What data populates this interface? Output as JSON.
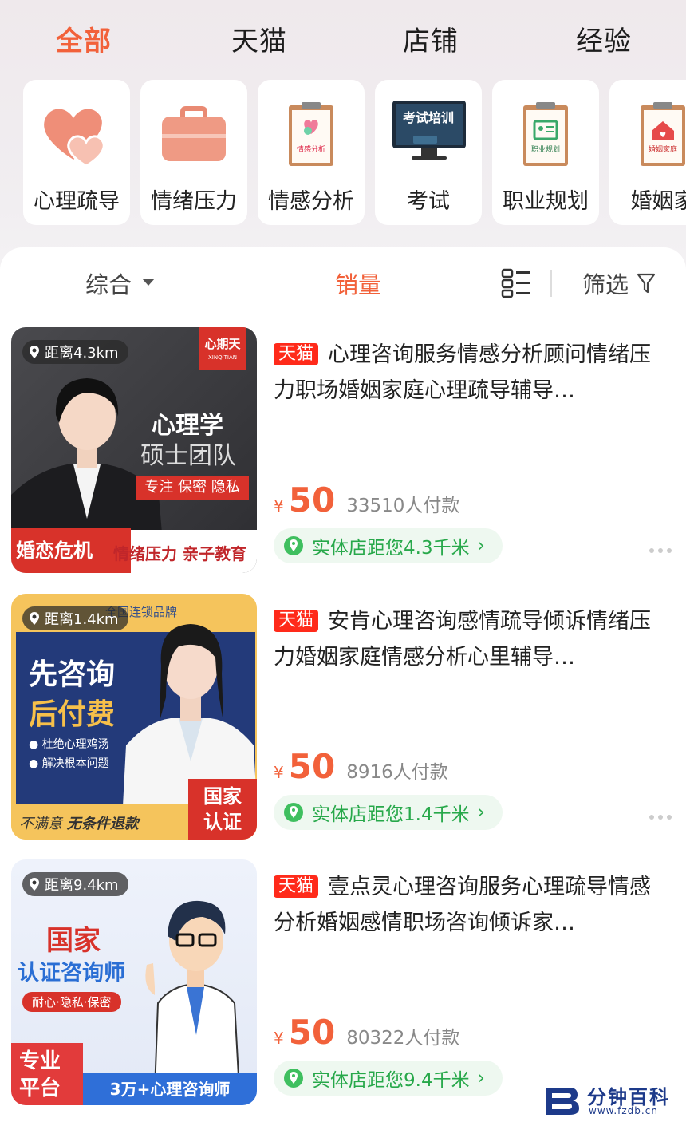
{
  "top_tabs": [
    "全部",
    "天猫",
    "店铺",
    "经验"
  ],
  "categories": [
    "心理疏导",
    "情绪压力",
    "情感分析",
    "考试",
    "职业规划",
    "婚姻家"
  ],
  "category_icon_text": {
    "emotion": "情感分析",
    "exam": "考试培训",
    "career": "职业规划",
    "marriage": "婚姻家庭"
  },
  "sort": {
    "comprehensive": "综合",
    "sales": "销量",
    "filter": "筛选"
  },
  "products": [
    {
      "distance": "距离4.3km",
      "tag": "天猫",
      "title": "心理咨询服务情感分析顾问情绪压力职场婚姻家庭心理疏导辅导…",
      "currency": "¥",
      "price": "50",
      "paid": "33510人付款",
      "store": "实体店距您4.3千米",
      "banner": {
        "brand": "心期天",
        "brand_en": "XINQITIAN",
        "line1": "心理学",
        "line2": "硕士团队",
        "red_bar": "专注 保密 隐私",
        "bottom_left": "婚恋危机",
        "bottom_right": "情绪压力 亲子教育"
      }
    },
    {
      "distance": "距离1.4km",
      "tag": "天猫",
      "title": "安肯心理咨询感情疏导倾诉情绪压力婚姻家庭情感分析心里辅导…",
      "currency": "¥",
      "price": "50",
      "paid": "8916人付款",
      "store": "实体店距您1.4千米",
      "banner": {
        "top": "全国连锁品牌",
        "line1": "先咨询",
        "line2": "后付费",
        "check1": "杜绝心理鸡汤",
        "check2": "解决根本问题",
        "bottom_left_a": "不满意 ",
        "bottom_left_b": "无条件退款",
        "badge1": "国家",
        "badge2": "认证"
      }
    },
    {
      "distance": "距离9.4km",
      "tag": "天猫",
      "title": "壹点灵心理咨询服务心理疏导情感分析婚姻感情职场咨询倾诉家…",
      "currency": "¥",
      "price": "50",
      "paid": "80322人付款",
      "store": "实体店距您9.4千米",
      "banner": {
        "line1": "国家",
        "line2": "认证咨询师",
        "pill": "耐心·隐私·保密",
        "corner1": "专业",
        "corner2": "平台",
        "bottom": "3万+心理咨询师"
      }
    }
  ],
  "watermark": {
    "title": "分钟百科",
    "url": "www.fzdb.cn"
  },
  "colors": {
    "accent": "#f2613a",
    "tmall": "#ff2a1a",
    "store_green": "#27a84a"
  }
}
